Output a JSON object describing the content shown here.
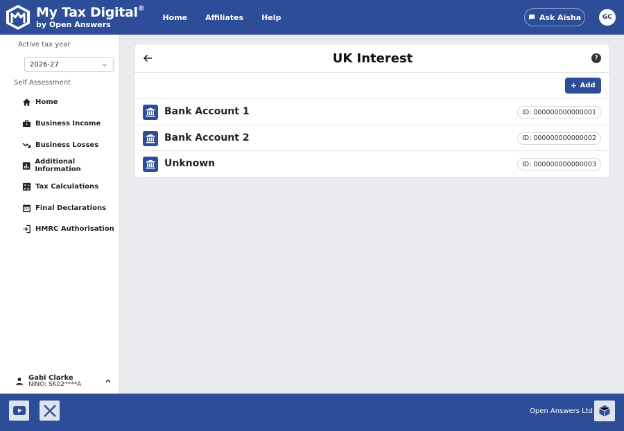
{
  "header": {
    "brand_title": "My Tax Digital",
    "brand_mark": "®",
    "brand_sub": "by Open Answers",
    "nav": [
      {
        "label": "Home"
      },
      {
        "label": "Affiliates"
      },
      {
        "label": "Help"
      }
    ],
    "ask_label": "Ask Aisha",
    "avatar_initials": "GC",
    "accent": "#2e4d98"
  },
  "sidebar": {
    "tax_year_label": "Active tax year",
    "tax_year_value": "2026-27",
    "section_label": "Self Assessment",
    "items": [
      {
        "label": "Home",
        "icon": "home-icon"
      },
      {
        "label": "Business Income",
        "icon": "briefcase-icon"
      },
      {
        "label": "Business Losses",
        "icon": "trending-down-icon"
      },
      {
        "label": "Additional Information",
        "icon": "bar-chart-icon"
      },
      {
        "label": "Tax Calculations",
        "icon": "calculator-icon"
      },
      {
        "label": "Final Declarations",
        "icon": "calendar-icon"
      },
      {
        "label": "HMRC Authorisation",
        "icon": "login-icon"
      }
    ],
    "user": {
      "name": "Gabi Clarke",
      "nino": "NINO: SK02****A"
    }
  },
  "main": {
    "title": "UK Interest",
    "add_label": "Add",
    "accounts": [
      {
        "name": "Bank Account 1",
        "id": "ID: 000000000000001"
      },
      {
        "name": "Bank Account 2",
        "id": "ID: 000000000000002"
      },
      {
        "name": "Unknown",
        "id": "ID: 000000000000003"
      }
    ]
  },
  "footer": {
    "company": "Open Answers Ltd"
  }
}
